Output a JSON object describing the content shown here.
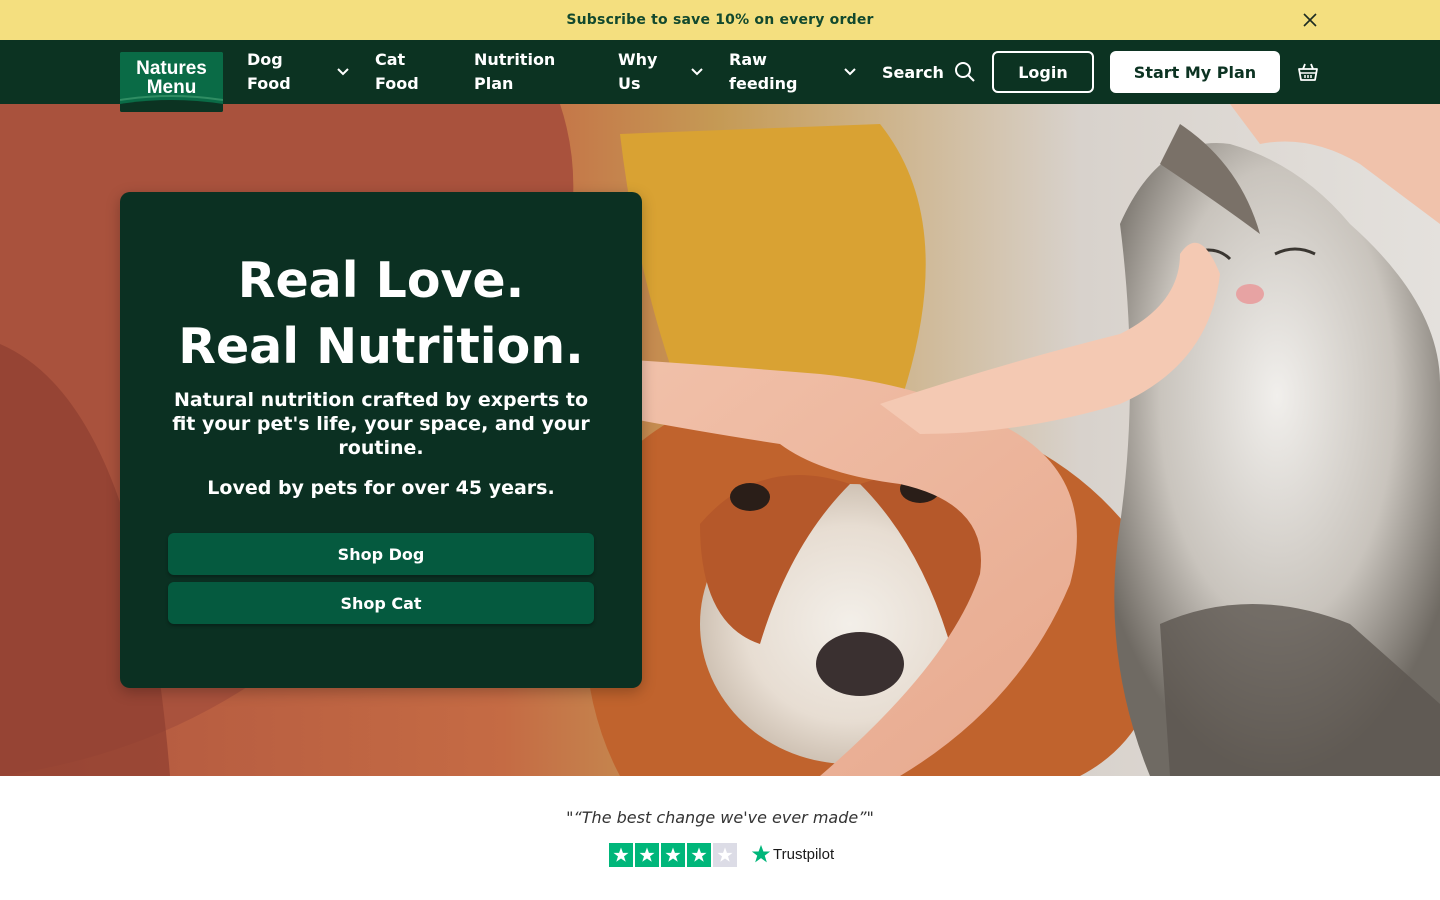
{
  "promo": {
    "text": "Subscribe to save 10% on every order",
    "close_icon": "close-icon"
  },
  "header": {
    "logo": {
      "line1": "Natures",
      "line2": "Menu"
    },
    "nav": [
      {
        "label": "Dog Food",
        "has_dropdown": true
      },
      {
        "label": "Cat Food",
        "has_dropdown": false
      },
      {
        "label": "Nutrition Plan",
        "has_dropdown": false
      },
      {
        "label": "Why Us",
        "has_dropdown": true
      },
      {
        "label": "Raw feeding",
        "has_dropdown": true
      }
    ],
    "search_label": "Search",
    "login_label": "Login",
    "cta_label": "Start My Plan",
    "basket_icon": "basket-icon"
  },
  "hero": {
    "title_line1": "Real Love.",
    "title_line2": "Real Nutrition.",
    "subtitle": "Natural nutrition crafted by experts to fit your pet's life, your space, and your routine.",
    "loved": "Loved by pets for over 45 years.",
    "shop_dog": "Shop Dog",
    "shop_cat": "Shop Cat"
  },
  "review": {
    "quote": "\"“The best change we've ever made”\"",
    "rating_stars": 4,
    "rating_max": 5,
    "trustpilot_label": "Trustpilot"
  },
  "colors": {
    "promo_bg": "#f4df7f",
    "header_bg": "#0c3322",
    "card_bg": "#0b3022",
    "button_green": "#055a3f",
    "trustpilot_green": "#00b67a"
  }
}
